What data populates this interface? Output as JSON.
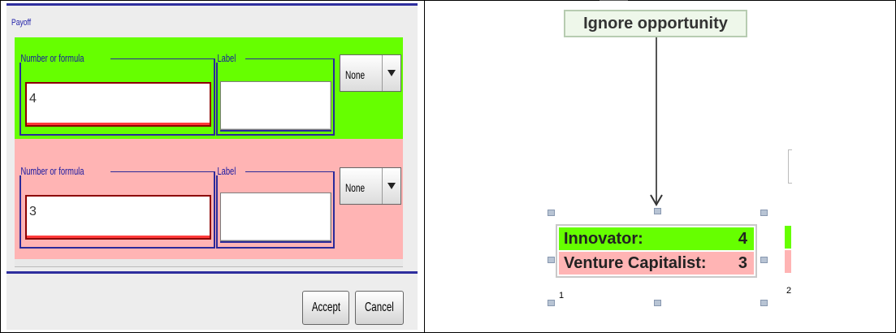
{
  "dialog": {
    "title": "Payoff",
    "players": [
      {
        "row_color": "#66ff00",
        "formula_legend": "Number or formula",
        "formula_value": "4",
        "label_legend": "Label",
        "label_value": "",
        "dropdown_value": "None"
      },
      {
        "row_color": "#ffb4b4",
        "formula_legend": "Number or formula",
        "formula_value": "3",
        "label_legend": "Label",
        "label_value": "",
        "dropdown_value": "None"
      }
    ],
    "buttons": {
      "accept": "Accept",
      "cancel": "Cancel"
    }
  },
  "tree": {
    "action_label": "Ignore opportunity",
    "payoffs": [
      {
        "player": "Innovator:",
        "value": "4",
        "color": "#66ff00"
      },
      {
        "player": "Venture Capitalist:",
        "value": "3",
        "color": "#ffb4b4"
      }
    ],
    "node_indices": [
      "1",
      "2"
    ]
  },
  "colors": {
    "accent": "#2e2e9e",
    "player1": "#66ff00",
    "player2": "#ffb4b4"
  }
}
